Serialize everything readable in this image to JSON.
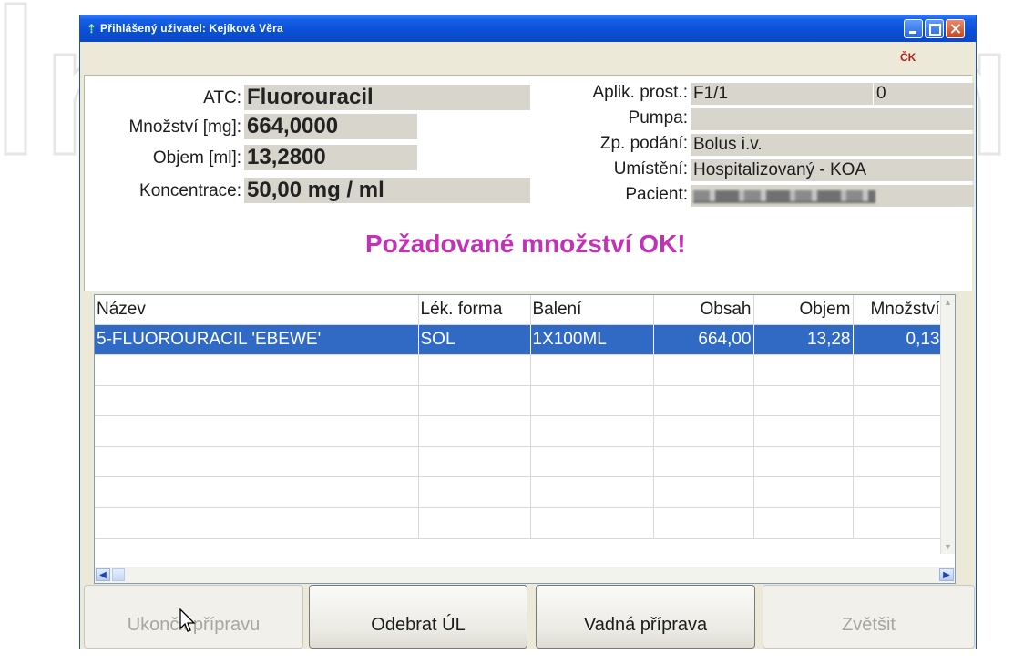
{
  "window": {
    "title": "Přihlášený uživatel: Kejíková Věra",
    "title_icon": "syringe-icon",
    "corner_tag": "ČK"
  },
  "info": {
    "atc_label": "ATC:",
    "atc_value": "Fluorouracil",
    "mnozstvi_label": "Množství [mg]:",
    "mnozstvi_value": "664,0000",
    "objem_label": "Objem [ml]:",
    "objem_value": "13,2800",
    "koncentrace_label": "Koncentrace:",
    "koncentrace_value": "50,00 mg / ml",
    "aplik_label": "Aplik. prost.:",
    "aplik_value": "F1/1",
    "aplik_extra": "0",
    "pumpa_label": "Pumpa:",
    "pumpa_value": "",
    "zp_podani_label": "Zp. podání:",
    "zp_podani_value": "Bolus i.v.",
    "umisteni_label": "Umístění:",
    "umisteni_value": "Hospitalizovaný - KOA",
    "pacient_label": "Pacient:"
  },
  "status_message": "Požadované množství OK!",
  "table": {
    "columns": [
      "Název",
      "Lék. forma",
      "Balení",
      "Obsah",
      "Objem",
      "Množství"
    ],
    "rows": [
      [
        "5-FLUOROURACIL 'EBEWE'",
        "SOL",
        "1X100ML",
        "664,00",
        "13,28",
        "0,13"
      ]
    ],
    "selected_row": 0
  },
  "buttons": {
    "ukoncit": "Ukončit přípravu",
    "odebrat": "Odebrat ÚL",
    "vadna": "Vadná příprava",
    "zvetsit": "Zvětšit"
  },
  "colors": {
    "titlebar": "#0a4fd6",
    "selection": "#316ac5",
    "status_text": "#c231b6",
    "field_bg": "#d8d6cc"
  }
}
